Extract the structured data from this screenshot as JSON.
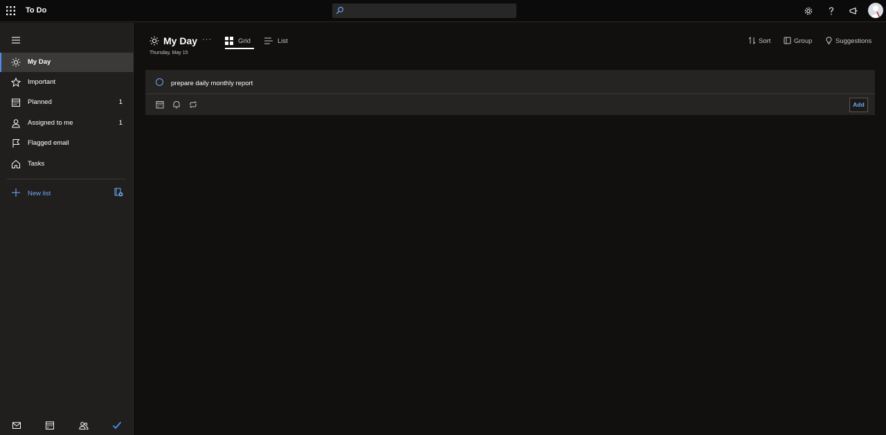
{
  "app": {
    "title": "To Do"
  },
  "search": {
    "value": "",
    "placeholder": ""
  },
  "topbar_icons": [
    "waffle-icon",
    "search-icon",
    "settings-icon",
    "help-icon",
    "feedback-icon",
    "avatar"
  ],
  "sidebar": {
    "items": [
      {
        "label": "My Day",
        "icon": "sun-icon",
        "count": "",
        "active": true
      },
      {
        "label": "Important",
        "icon": "star-icon",
        "count": ""
      },
      {
        "label": "Planned",
        "icon": "calendar-icon",
        "count": "1"
      },
      {
        "label": "Assigned to me",
        "icon": "person-icon",
        "count": "1"
      },
      {
        "label": "Flagged email",
        "icon": "flag-icon",
        "count": ""
      },
      {
        "label": "Tasks",
        "icon": "home-icon",
        "count": ""
      }
    ],
    "new_list_label": "New list",
    "bottom_icons": [
      "mail-icon",
      "calendar-icon",
      "people-icon",
      "todo-check-icon"
    ]
  },
  "header": {
    "title": "My Day",
    "date": "Thursday, May 15",
    "more": "···",
    "views": [
      {
        "label": "Grid",
        "icon": "grid-icon",
        "selected": true
      },
      {
        "label": "List",
        "icon": "list-icon",
        "selected": false
      }
    ],
    "commands": [
      {
        "label": "Sort",
        "icon": "sort-icon"
      },
      {
        "label": "Group",
        "icon": "group-icon"
      },
      {
        "label": "Suggestions",
        "icon": "lightbulb-icon"
      }
    ]
  },
  "task_entry": {
    "value": "prepare daily monthly report",
    "add_label": "Add",
    "tools": [
      "due-date-icon",
      "reminder-icon",
      "repeat-icon"
    ]
  },
  "colors": {
    "accent": "#4f8cf0",
    "link": "#6ea7f5",
    "background": "#11100f",
    "sidebar": "#201f1e",
    "card": "#252423"
  }
}
